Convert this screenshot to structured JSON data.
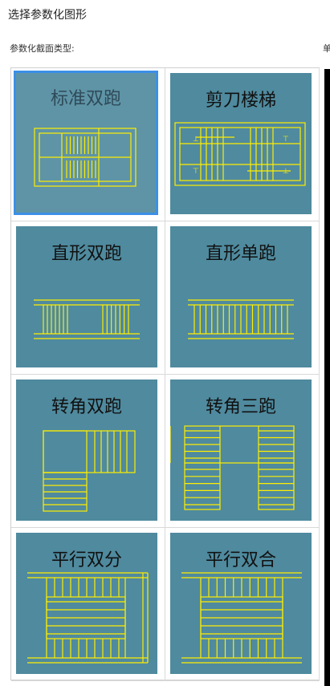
{
  "header": {
    "title": "选择参数化图形",
    "section_label": "参数化截面类型:",
    "side_label": "单"
  },
  "stairs": [
    {
      "label": "标准双跑",
      "icon": "standard-double-flight-stair",
      "selected": true
    },
    {
      "label": "剪刀楼梯",
      "icon": "scissor-stair",
      "selected": false
    },
    {
      "label": "直形双跑",
      "icon": "straight-double-flight-stair",
      "selected": false
    },
    {
      "label": "直形单跑",
      "icon": "straight-single-flight-stair",
      "selected": false
    },
    {
      "label": "转角双跑",
      "icon": "corner-double-flight-stair",
      "selected": false
    },
    {
      "label": "转角三跑",
      "icon": "corner-triple-flight-stair",
      "selected": false
    },
    {
      "label": "平行双分",
      "icon": "parallel-split-stair",
      "selected": false
    },
    {
      "label": "平行双合",
      "icon": "parallel-merge-stair",
      "selected": false
    }
  ],
  "colors": {
    "tile": "#4f8a9e",
    "line": "#ffee00",
    "selection": "#3b8fe6"
  }
}
